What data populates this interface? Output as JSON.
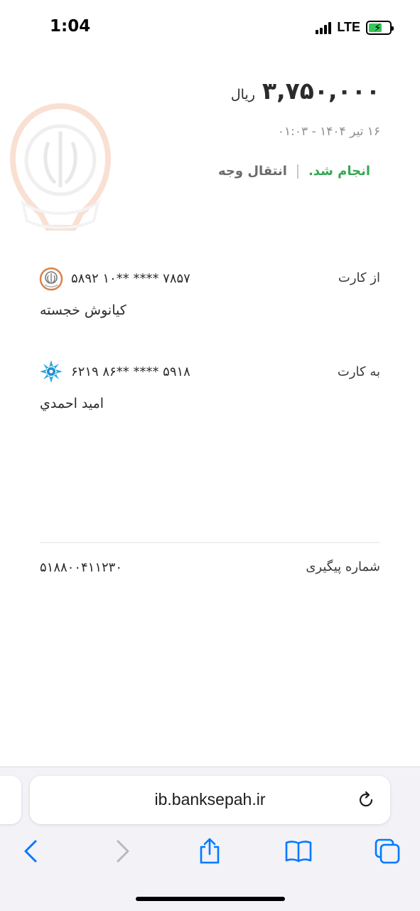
{
  "status_bar": {
    "time": "1:04",
    "network": "LTE",
    "battery_level": 0.55
  },
  "transaction": {
    "amount": "۳,۷۵۰,۰۰۰",
    "currency": "ریال",
    "datetime": "۱۶ تیر ۱۴۰۴ - ۰۱:۰۳",
    "status": "انجام شد.",
    "type": "انتقال وجه"
  },
  "from_card": {
    "label": "از کارت",
    "number": "۵۸۹۲ ۱۰** **** ۷۸۵۷",
    "holder": "کیانوش خجسته",
    "bank_icon": "bank-sepah-logo-icon"
  },
  "to_card": {
    "label": "به کارت",
    "number": "۶۲۱۹ ۸۶** **** ۵۹۱۸",
    "holder": "اميد احمدي",
    "bank_icon": "bank-saman-logo-icon"
  },
  "tracking": {
    "label": "شماره پیگیری",
    "value": "۵۱۸۸۰۰۴۱۱۲۳۰"
  },
  "browser": {
    "url": "ib.banksepah.ir",
    "toolbar_icons": [
      "back-icon",
      "forward-icon",
      "share-icon",
      "bookmarks-icon",
      "tabs-icon"
    ]
  },
  "colors": {
    "success": "#34a853",
    "accent": "#007aff",
    "watermark": "#e8743b"
  }
}
